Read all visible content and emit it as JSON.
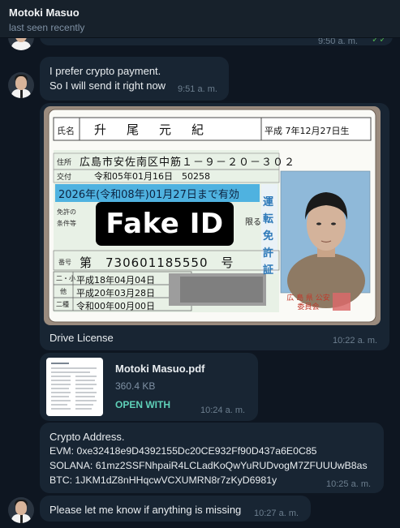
{
  "header": {
    "name": "Motoki Masuo",
    "status": "last seen recently"
  },
  "prev_message": {
    "time": "9:50 a. m."
  },
  "messages": {
    "m1": {
      "line1": "I prefer crypto payment.",
      "line2": "So I will send it right now",
      "time": "9:51 a. m."
    },
    "m2": {
      "caption": "Drive License",
      "time": "10:22 a. m.",
      "overlay": "Fake ID",
      "card": {
        "name_label": "氏名",
        "name": "升　尾　元　紀",
        "birth": "平成 7年12月27日生",
        "address_label": "住所",
        "address": "広島市安佐南区中筋１－９－２０－３０２",
        "issue_label": "交付",
        "issue": "令和05年01月16日　50258",
        "expiry": "2026年(令和08年)01月27日まで有効",
        "conditions_label": "免許の条件等",
        "conditions": "限る",
        "number_label": "番号",
        "number": "第　730601185550　号",
        "history_labels": [
          "二・小",
          "他",
          "二種"
        ],
        "history": [
          "平成18年04月04日",
          "平成20年03月28日",
          "令和00年00月00日"
        ],
        "side_text": "運転免許証",
        "authority": "広 島 県 公安委員会"
      }
    },
    "m3": {
      "file_name": "Motoki Masuo.pdf",
      "size": "360.4 KB",
      "action": "OPEN WITH",
      "time": "10:24 a. m."
    },
    "m4": {
      "title": "Crypto Address.",
      "evm": "EVM: 0xe32418e9D4392155Dc20CE932Ff90D437a6E0C85",
      "solana": "SOLANA: 61mz2SSFNhpaiR4LCLadKoQwYuRUDvogM7ZFUUUwB8as",
      "btc": "BTC: 1JKM1dZ8nHHqcwVCXUMRN8r7zKyD6981y",
      "time": "10:25 a. m."
    },
    "m5": {
      "text": "Please let me know if anything is missing",
      "time": "10:27 a. m."
    }
  }
}
